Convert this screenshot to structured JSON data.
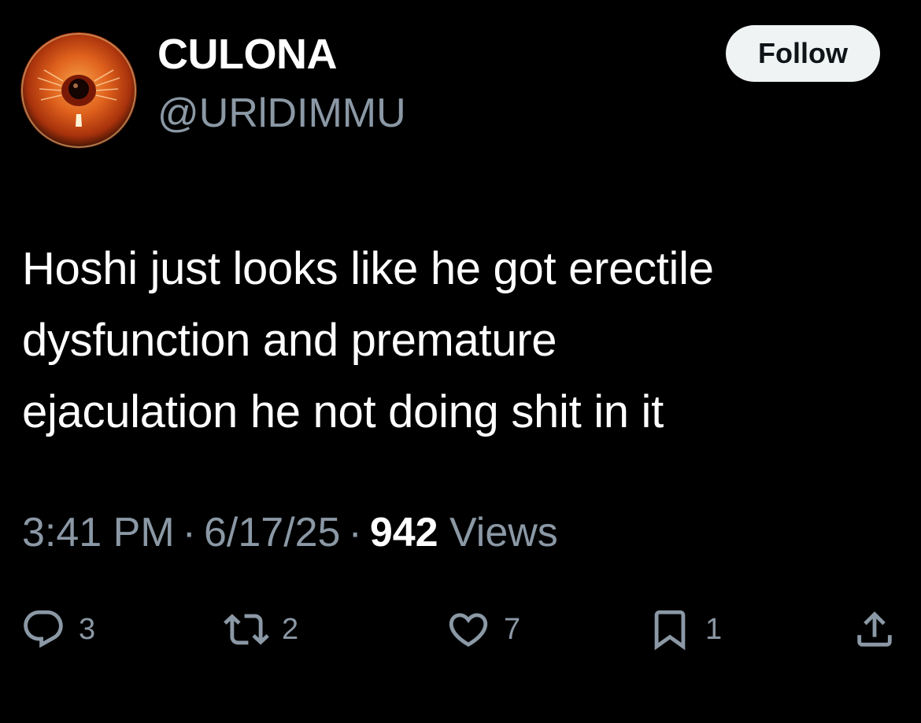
{
  "author": {
    "display_name": "CULONA",
    "handle": "@URlDIMMU",
    "avatar_icon": "eye-avatar-icon"
  },
  "follow_button": {
    "label": "Follow"
  },
  "tweet": {
    "lines": [
      "Hoshi just looks like he got erectile",
      "dysfunction and premature",
      "ejaculation he not doing shit in it"
    ]
  },
  "meta": {
    "time": "3:41 PM",
    "separator": "·",
    "date": "6/17/25",
    "views_count": "942",
    "views_label": "Views"
  },
  "actions": {
    "reply": {
      "icon": "reply-icon",
      "count": "3"
    },
    "repost": {
      "icon": "repost-icon",
      "count": "2"
    },
    "like": {
      "icon": "heart-icon",
      "count": "7"
    },
    "bookmark": {
      "icon": "bookmark-icon",
      "count": "1"
    },
    "share": {
      "icon": "share-icon"
    }
  },
  "colors": {
    "background": "#000000",
    "primary_text": "#ffffff",
    "secondary_text": "#8b98a5",
    "follow_bg": "#eff3f4",
    "follow_text": "#0f1419"
  }
}
